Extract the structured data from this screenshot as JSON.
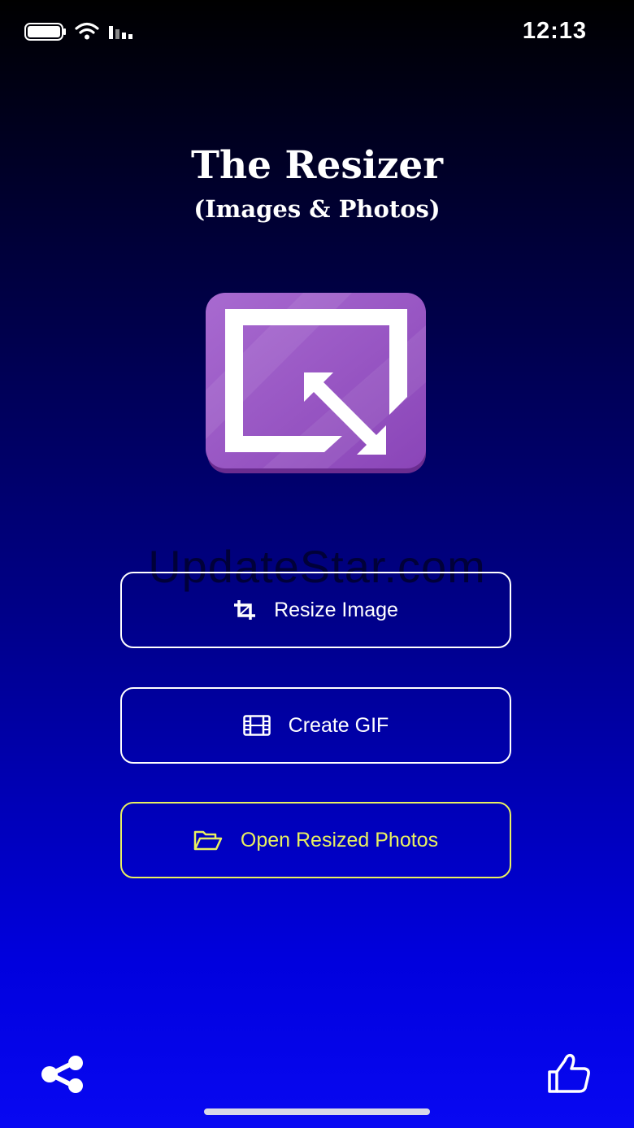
{
  "status_bar": {
    "time": "12:13"
  },
  "app": {
    "title": "The Resizer",
    "subtitle": "(Images & Photos)",
    "logo_icon": "resize-arrow-icon"
  },
  "watermark": "UpdateStar.com",
  "buttons": [
    {
      "label": "Resize Image",
      "icon": "crop-icon",
      "color": "#ffffff"
    },
    {
      "label": "Create GIF",
      "icon": "film-icon",
      "color": "#ffffff"
    },
    {
      "label": "Open Resized Photos",
      "icon": "folder-open-icon",
      "color": "#e8f060"
    }
  ],
  "bottom_bar": {
    "left_icon": "share-icon",
    "right_icon": "thumbs-up-icon"
  },
  "colors": {
    "accent": "#e8f060",
    "logo_purple": "#9b55c4",
    "background_bottom": "#0808f2"
  }
}
